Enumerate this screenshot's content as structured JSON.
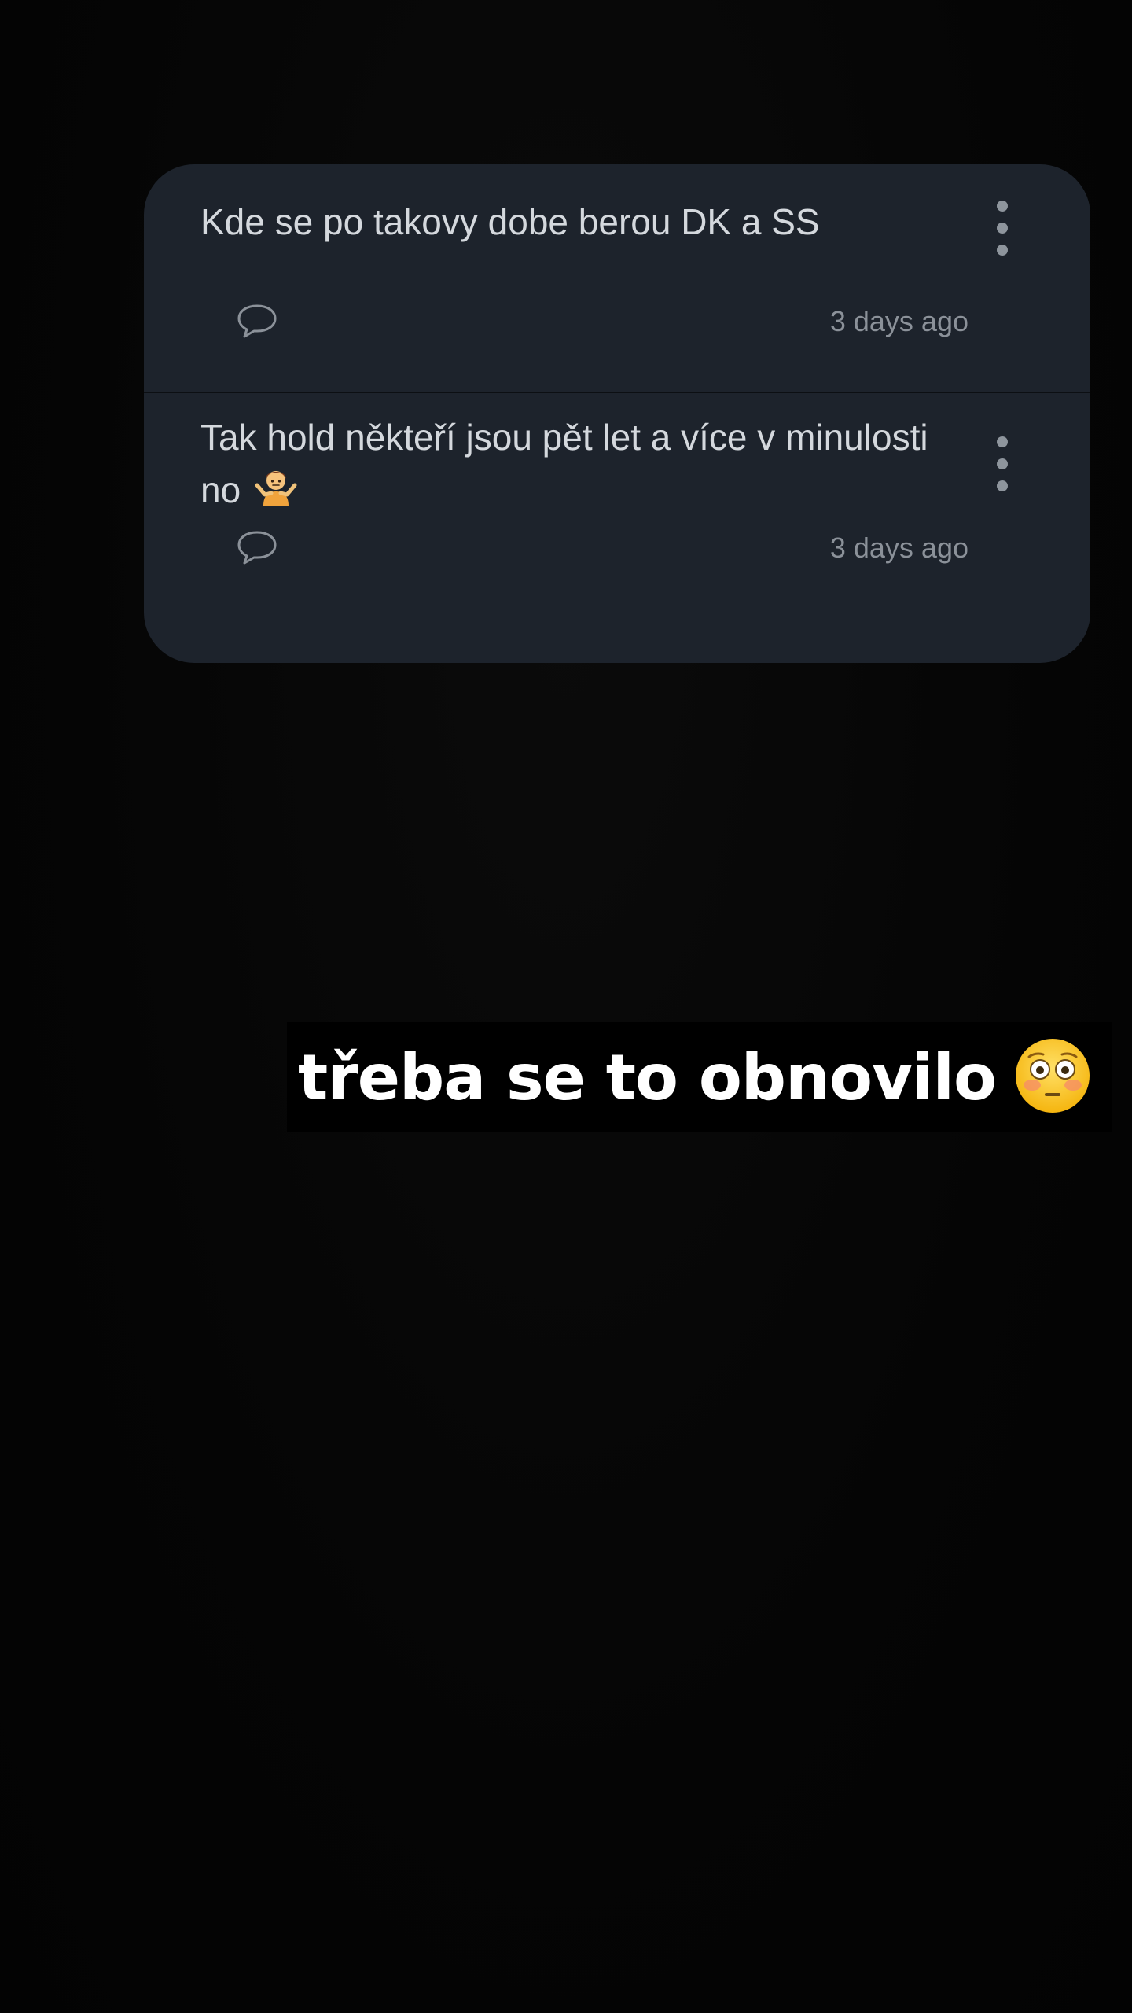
{
  "comments": [
    {
      "text": "Kde se po takovy dobe berou DK a SS",
      "timestamp": "3 days ago",
      "reply_icon": "speech-bubble-icon",
      "menu_icon": "more-vertical-icon"
    },
    {
      "text": "Tak hold někteří jsou pět let a více v minulosti no",
      "emoji": "person-shrugging",
      "timestamp": "3 days ago",
      "reply_icon": "speech-bubble-icon",
      "menu_icon": "more-vertical-icon"
    }
  ],
  "caption": {
    "text": "třeba se to obnovilo",
    "emoji": "flushed-face"
  },
  "colors": {
    "background": "#050505",
    "card": "#1d232c",
    "comment_text": "#d4d8dd",
    "meta_text": "#8b9199",
    "caption_text": "#ffffff"
  }
}
